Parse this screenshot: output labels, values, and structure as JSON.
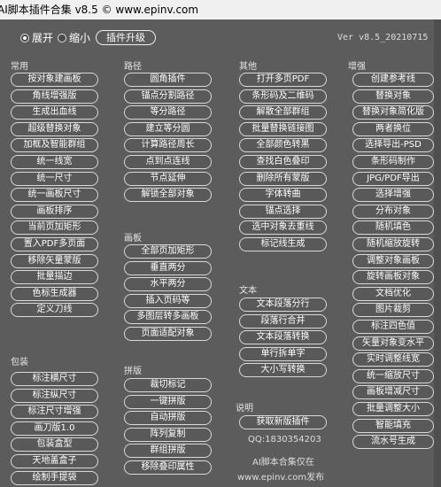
{
  "window": {
    "title": "AI脚本插件合集 v8.5 © www.epinv.com"
  },
  "topbar": {
    "expand_label": "展开",
    "collapse_label": "缩小",
    "upgrade_label": "插件升级",
    "version": "Ver v8.5_20210715"
  },
  "col1": {
    "header_common": "常用",
    "common": [
      "按对象建画板",
      "角线增强版",
      "生成出血线",
      "超级替换对象",
      "加框及智能群组",
      "统一线宽",
      "统一尺寸",
      "统一画板尺寸",
      "画板排序",
      "当前页加矩形",
      "置入PDF多页面",
      "移除矢量蒙版",
      "批量描边",
      "色标生成器",
      "定义刀线"
    ],
    "header_pack": "包装",
    "pack": [
      "标注横尺寸",
      "标注纵尺寸",
      "标注尺寸增强",
      "画刀版1.0",
      "包装盒型",
      "天地盖盒子",
      "绘制手提袋"
    ]
  },
  "col2": {
    "header_path": "路径",
    "path": [
      "圆角插件",
      "锚点分割路径",
      "等分路径",
      "建立等分圆",
      "计算路径周长",
      "点到点连线",
      "节点延伸",
      "解锁全部对象"
    ],
    "header_artboard": "画板",
    "artboard": [
      "全部页加矩形",
      "垂直两分",
      "水平两分",
      "插入页码等",
      "多图层转多画板",
      "页面适配对象"
    ],
    "header_imposition": "拼版",
    "imposition": [
      "裁切标记",
      "一键拼版",
      "自动拼版",
      "阵列复制",
      "群组拼版",
      "移除叠印属性"
    ]
  },
  "col3": {
    "header_other": "其他",
    "other": [
      "打开多页PDF",
      "条形码及二维码",
      "解散全部群组",
      "批量替换链接图",
      "全部颜色转黑",
      "查找白色叠印",
      "删除所有蒙版",
      "字体转曲",
      "锚点选择",
      "选中对象去重线",
      "标记线生成"
    ],
    "header_text": "文本",
    "text": [
      "文本段落分行",
      "段落行合并",
      "文本段落转换",
      "单行拆单字",
      "大小写转换"
    ],
    "header_about": "说明",
    "about_button": "获取新版插件",
    "qq": "QQ:1830354203",
    "note1": "AI脚本合集仅在",
    "note2": "www.epinv.com发布"
  },
  "col4": {
    "header_enhance": "增强",
    "enhance": [
      "创建参考线",
      "替换对象",
      "替换对象简化版",
      "两者换位",
      "选择导出-PSD",
      "条形码制作",
      "JPG/PDF导出",
      "选择增强",
      "分布对象",
      "随机填色",
      "随机缩放旋转",
      "调整对象画板",
      "旋转画板对象",
      "文档优化",
      "图片裁剪",
      "标注四色值",
      "矢量对象变水平",
      "实时调整线宽",
      "统一缩放尺寸",
      "画板增减尺寸",
      "批量调整大小",
      "智能填充",
      "流水号生成"
    ]
  }
}
